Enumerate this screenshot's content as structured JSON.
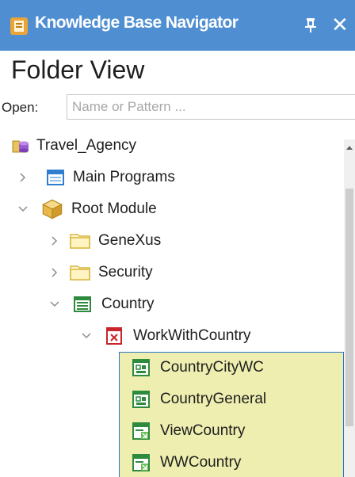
{
  "window": {
    "title": "Knowledge Base Navigator",
    "close_glyph": "✕",
    "title_bar_color": "#4f8fd1"
  },
  "view": {
    "title": "Folder View"
  },
  "open": {
    "label": "Open:",
    "placeholder": "Name or Pattern ..."
  },
  "tree": {
    "root": {
      "label": "Travel_Agency",
      "icon": "database-icon"
    },
    "items": [
      {
        "label": "Main Programs",
        "icon": "main-programs-icon",
        "expanded": false
      },
      {
        "label": "Root Module",
        "icon": "module-icon",
        "expanded": true
      },
      {
        "label": "GeneXus",
        "icon": "folder-icon",
        "expanded": false
      },
      {
        "label": "Security",
        "icon": "folder-icon",
        "expanded": false
      },
      {
        "label": "Country",
        "icon": "transaction-icon",
        "expanded": true
      },
      {
        "label": "WorkWithCountry",
        "icon": "pattern-icon",
        "expanded": true
      },
      {
        "label": "CountryCityWC",
        "icon": "web-component-icon",
        "selected": true
      },
      {
        "label": "CountryGeneral",
        "icon": "web-component-icon",
        "selected": true
      },
      {
        "label": "ViewCountry",
        "icon": "web-panel-icon",
        "selected": true
      },
      {
        "label": "WWCountry",
        "icon": "web-panel-icon",
        "selected": true
      }
    ]
  },
  "colors": {
    "selection_background": "#eeeeb0",
    "selection_border": "#2b73c7"
  }
}
